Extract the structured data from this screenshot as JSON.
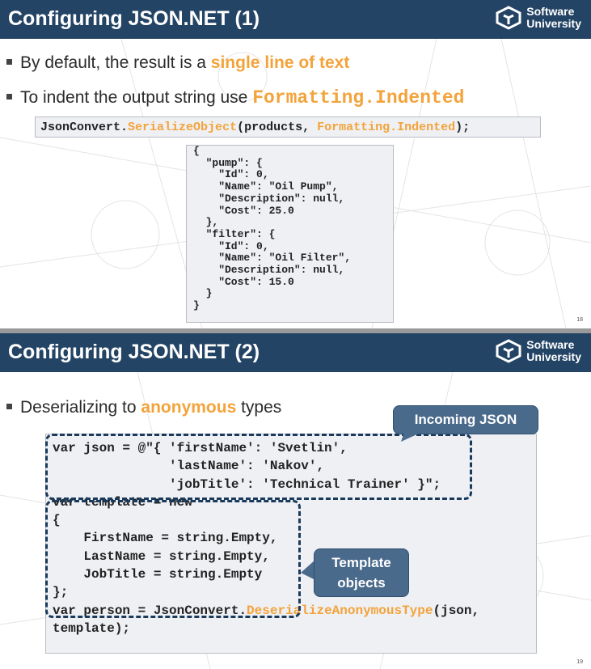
{
  "slide1": {
    "title": "Configuring JSON.NET (1)",
    "logo": {
      "line1": "Software",
      "line2": "University"
    },
    "bullet1": {
      "prefix": "By default, the result is a ",
      "highlight": "single line of text"
    },
    "bullet2": {
      "prefix": "To indent the output string use ",
      "highlight": "Formatting.Indented"
    },
    "code": {
      "part1": "JsonConvert.",
      "method": "SerializeObject",
      "part2": "(products, ",
      "arg": "Formatting.Indented",
      "part3": ");"
    },
    "json_output": "{\n  \"pump\": {\n    \"Id\": 0,\n    \"Name\": \"Oil Pump\",\n    \"Description\": null,\n    \"Cost\": 25.0\n  },\n  \"filter\": {\n    \"Id\": 0,\n    \"Name\": \"Oil Filter\",\n    \"Description\": null,\n    \"Cost\": 15.0\n  }\n}",
    "page_number": "18"
  },
  "slide2": {
    "title": "Configuring JSON.NET (2)",
    "logo": {
      "line1": "Software",
      "line2": "University"
    },
    "bullet1": {
      "prefix": "Deserializing to ",
      "highlight": "anonymous",
      "suffix": " types"
    },
    "code_json": "var json = @\"{ 'firstName': 'Svetlin',\n               'lastName': 'Nakov',\n               'jobTitle': 'Technical Trainer' }\";",
    "code_template": "var template = new\n{\n    FirstName = string.Empty,\n    LastName = string.Empty,\n    JobTitle = string.Empty\n};",
    "code_person": {
      "part1": "var person = JsonConvert.",
      "method": "DeserializeAnonymousType",
      "part2": "(json,",
      "line2": "template);"
    },
    "callout_json": "Incoming JSON",
    "callout_template": "Template objects",
    "page_number": "19"
  },
  "colors": {
    "title_bar": "#234465",
    "accent": "#f3a33a",
    "callout": "#4a6a8c",
    "code_bg": "#eef0f4",
    "dash": "#1a3a5c"
  }
}
